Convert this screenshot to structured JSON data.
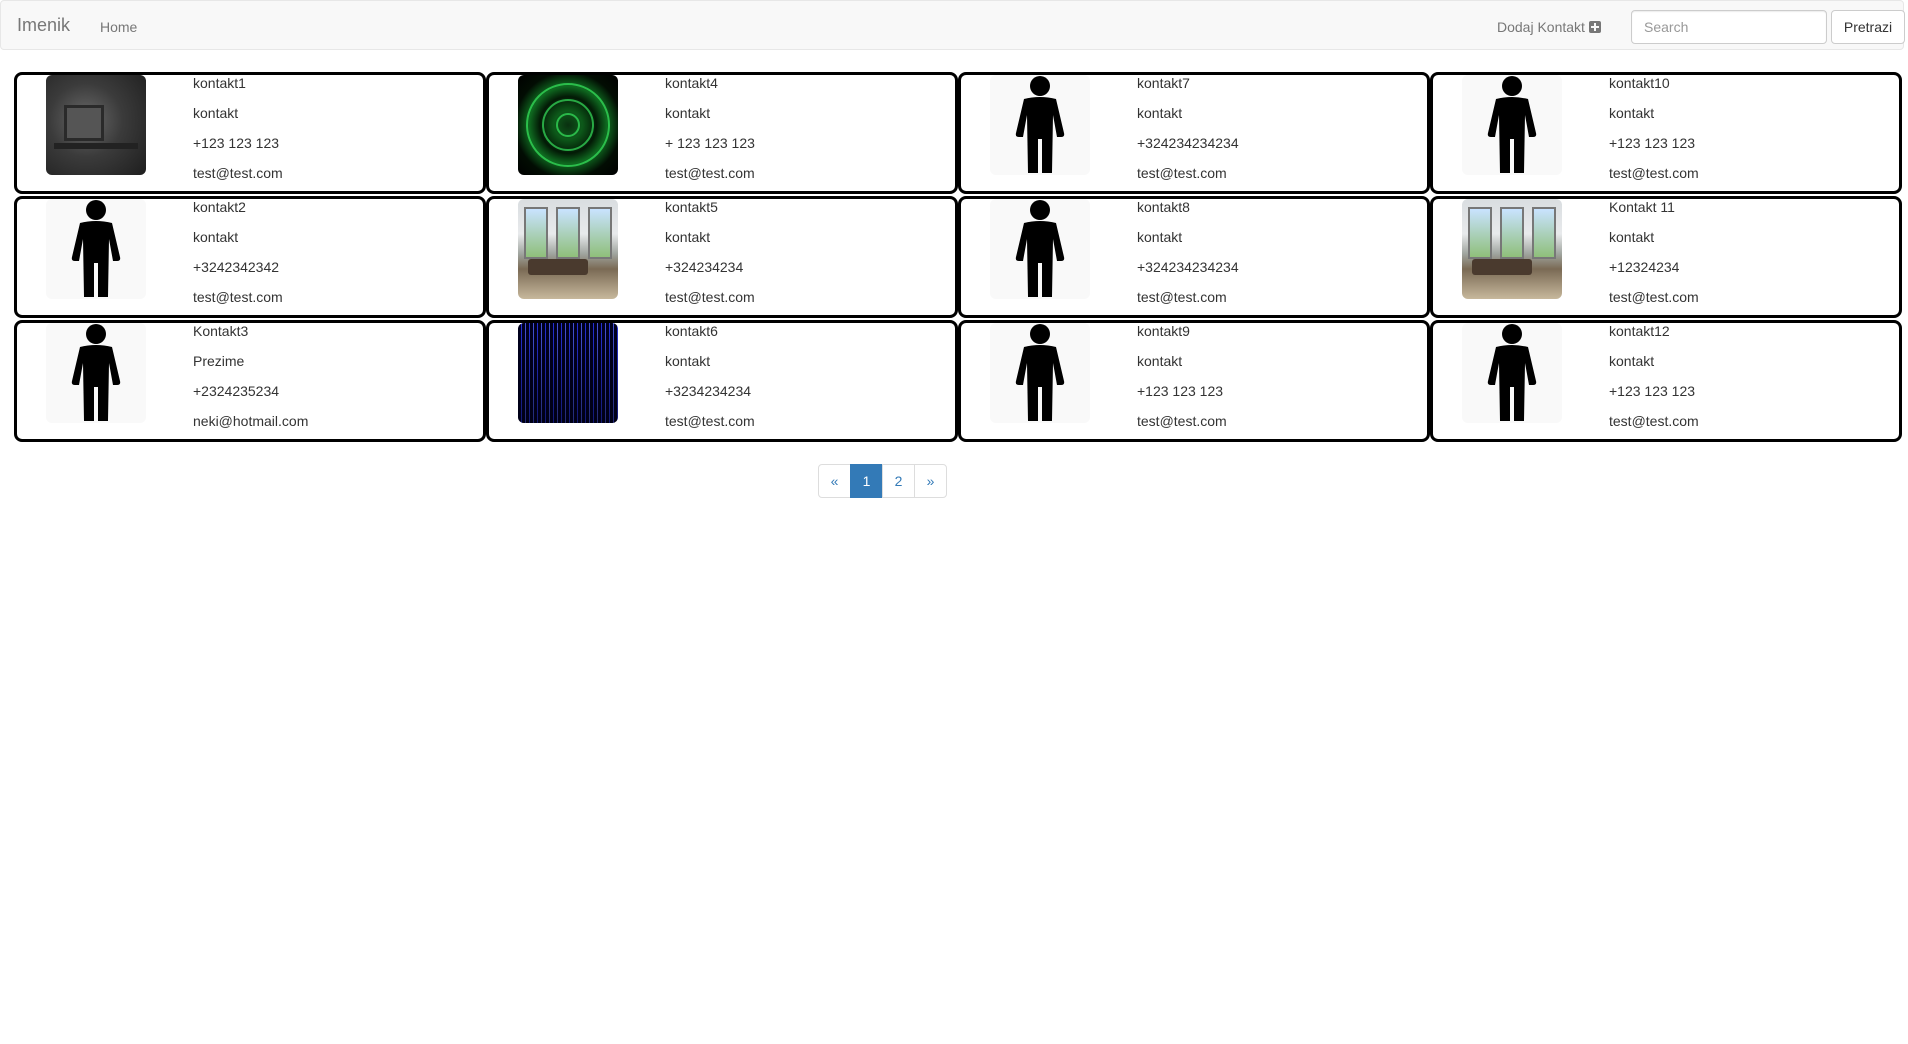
{
  "navbar": {
    "brand": "Imenik",
    "home": "Home",
    "add_contact": "Dodaj Kontakt",
    "search_placeholder": "Search",
    "search_button": "Pretrazi"
  },
  "contacts": [
    {
      "name": "kontakt1",
      "surname": "kontakt",
      "phone": "+123 123 123",
      "email": "test@test.com",
      "photo": "dark-stone-desk-image"
    },
    {
      "name": "kontakt4",
      "surname": "kontakt",
      "phone": "+ 123 123 123",
      "email": "test@test.com",
      "photo": "green-radar-image"
    },
    {
      "name": "kontakt7",
      "surname": "kontakt",
      "phone": "+324234234234",
      "email": "test@test.com",
      "photo": "person-silhouette"
    },
    {
      "name": "kontakt10",
      "surname": "kontakt",
      "phone": "+123 123 123",
      "email": "test@test.com",
      "photo": "person-silhouette"
    },
    {
      "name": "kontakt2",
      "surname": "kontakt",
      "phone": "+3242342342",
      "email": "test@test.com",
      "photo": "person-silhouette"
    },
    {
      "name": "kontakt5",
      "surname": "kontakt",
      "phone": "+324234234",
      "email": "test@test.com",
      "photo": "living-room-image"
    },
    {
      "name": "kontakt8",
      "surname": "kontakt",
      "phone": "+324234234234",
      "email": "test@test.com",
      "photo": "person-silhouette"
    },
    {
      "name": "Kontakt 11",
      "surname": "kontakt",
      "phone": "+12324234",
      "email": "test@test.com",
      "photo": "living-room-image"
    },
    {
      "name": "Kontakt3",
      "surname": "Prezime",
      "phone": "+2324235234",
      "email": "neki@hotmail.com",
      "photo": "person-silhouette"
    },
    {
      "name": "kontakt6",
      "surname": "kontakt",
      "phone": "+3234234234",
      "email": "test@test.com",
      "photo": "blue-matrix-image"
    },
    {
      "name": "kontakt9",
      "surname": "kontakt",
      "phone": "+123 123 123",
      "email": "test@test.com",
      "photo": "person-silhouette"
    },
    {
      "name": "kontakt12",
      "surname": "kontakt",
      "phone": "+123 123 123",
      "email": "test@test.com",
      "photo": "person-silhouette"
    }
  ],
  "pagination": {
    "prev": "«",
    "pages": [
      "1",
      "2"
    ],
    "active_page": "1",
    "next": "»"
  },
  "colors": {
    "accent": "#337ab7",
    "navbar_bg": "#f8f8f8",
    "card_border": "#000000"
  }
}
